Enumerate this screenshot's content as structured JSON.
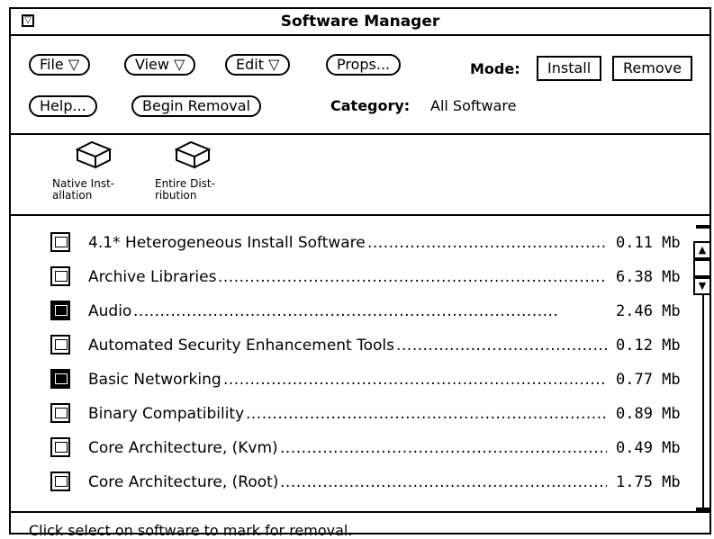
{
  "window": {
    "title": "Software Manager",
    "menu_icon": "window-menu-icon"
  },
  "controls": {
    "file": "File ▽",
    "view": "View ▽",
    "edit": "Edit ▽",
    "props": "Props...",
    "help": "Help...",
    "begin_removal": "Begin Removal"
  },
  "mode": {
    "label": "Mode:",
    "install": "Install",
    "remove": "Remove",
    "selected": "Remove"
  },
  "category": {
    "label": "Category:",
    "value": "All Software"
  },
  "toolbar": {
    "native": "Native Inst- allation",
    "entire": "Entire Dist- ribution"
  },
  "packages": [
    {
      "name": "4.1* Heterogeneous Install Software",
      "size": "0.11 Mb",
      "icon": "package-icon"
    },
    {
      "name": "Archive Libraries",
      "size": "6.38 Mb",
      "icon": "package-icon"
    },
    {
      "name": "Audio",
      "size": "2.46 Mb",
      "icon": "cluster-icon"
    },
    {
      "name": "Automated Security Enhancement Tools",
      "size": "0.12 Mb",
      "icon": "package-icon"
    },
    {
      "name": "Basic Networking",
      "size": "0.77 Mb",
      "icon": "cluster-icon"
    },
    {
      "name": "Binary Compatibility",
      "size": "0.89 Mb",
      "icon": "package-icon"
    },
    {
      "name": "Core Architecture, (Kvm)",
      "size": "0.49 Mb",
      "icon": "package-icon"
    },
    {
      "name": "Core Architecture, (Root)",
      "size": "1.75 Mb",
      "icon": "package-icon"
    }
  ],
  "footer": {
    "message": "Click select on software to mark for removal."
  }
}
